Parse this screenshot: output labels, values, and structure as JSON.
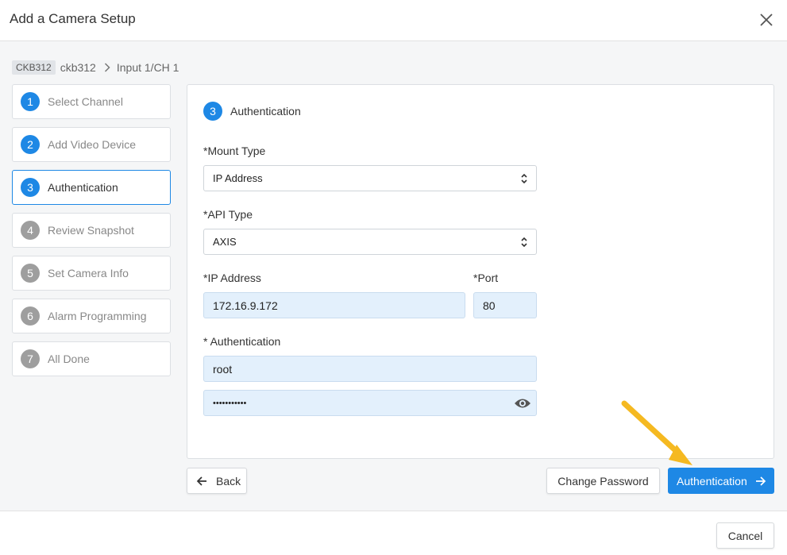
{
  "dialog": {
    "title": "Add a Camera Setup"
  },
  "breadcrumb": {
    "chip": "CKB312",
    "name": "ckb312",
    "input": "Input 1/CH 1"
  },
  "steps": [
    {
      "num": "1",
      "label": "Select Channel"
    },
    {
      "num": "2",
      "label": "Add Video Device"
    },
    {
      "num": "3",
      "label": "Authentication"
    },
    {
      "num": "4",
      "label": "Review Snapshot"
    },
    {
      "num": "5",
      "label": "Set Camera Info"
    },
    {
      "num": "6",
      "label": "Alarm Programming"
    },
    {
      "num": "7",
      "label": "All Done"
    }
  ],
  "form": {
    "step_num": "3",
    "title": "Authentication",
    "mount_type_label": "*Mount Type",
    "mount_type_value": "IP Address",
    "api_type_label": "*API Type",
    "api_type_value": "AXIS",
    "ip_label": "*IP Address",
    "ip_value": "172.16.9.172",
    "port_label": "*Port",
    "port_value": "80",
    "auth_label": "* Authentication",
    "username_value": "root",
    "password_value": "•••••••••••"
  },
  "actions": {
    "back": "Back",
    "change_password": "Change Password",
    "authenticate": "Authentication",
    "cancel": "Cancel"
  },
  "colors": {
    "accent": "#1e88e5",
    "inactive": "#9e9e9e",
    "annotation_arrow": "#f5b921"
  }
}
